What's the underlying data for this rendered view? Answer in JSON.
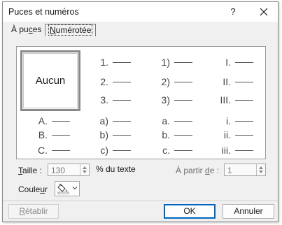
{
  "dialog": {
    "title": "Puces et numéros",
    "help": "?",
    "close_icon": "close-icon"
  },
  "tabs": [
    {
      "pre": "À pu",
      "ul": "c",
      "post": "es",
      "active": false
    },
    {
      "pre": "",
      "ul": "N",
      "post": "umérotée",
      "active": true
    }
  ],
  "gallery": {
    "none_label": "Aucun",
    "cells": [
      {
        "label": "1."
      },
      {
        "label": "1)"
      },
      {
        "label": "I."
      },
      {
        "label": "2."
      },
      {
        "label": "2)"
      },
      {
        "label": "II."
      },
      {
        "label": "3."
      },
      {
        "label": "3)"
      },
      {
        "label": "III."
      },
      {
        "label": "A."
      },
      {
        "label": "a)"
      },
      {
        "label": "a."
      },
      {
        "label": "i."
      },
      {
        "label": "B."
      },
      {
        "label": "b)"
      },
      {
        "label": "b."
      },
      {
        "label": "ii."
      },
      {
        "label": "C."
      },
      {
        "label": "c)"
      },
      {
        "label": "c."
      },
      {
        "label": "iii."
      }
    ]
  },
  "size": {
    "label_ul": "T",
    "label_rest": "aille :",
    "value": "130",
    "suffix": "% du texte"
  },
  "start_at": {
    "label_pre": "À partir ",
    "label_ul": "d",
    "label_post": "e :",
    "value": "1"
  },
  "color": {
    "label_pre": "Coule",
    "label_ul": "u",
    "label_post": "r",
    "icon": "paint-bucket-icon"
  },
  "buttons": {
    "reset_ul": "R",
    "reset_rest": "établir",
    "ok": "OK",
    "cancel": "Annuler"
  },
  "colors": {
    "accent": "#0067c0",
    "dialog_bg": "#f0f0f0",
    "selection_border": "#8a8a8a"
  }
}
